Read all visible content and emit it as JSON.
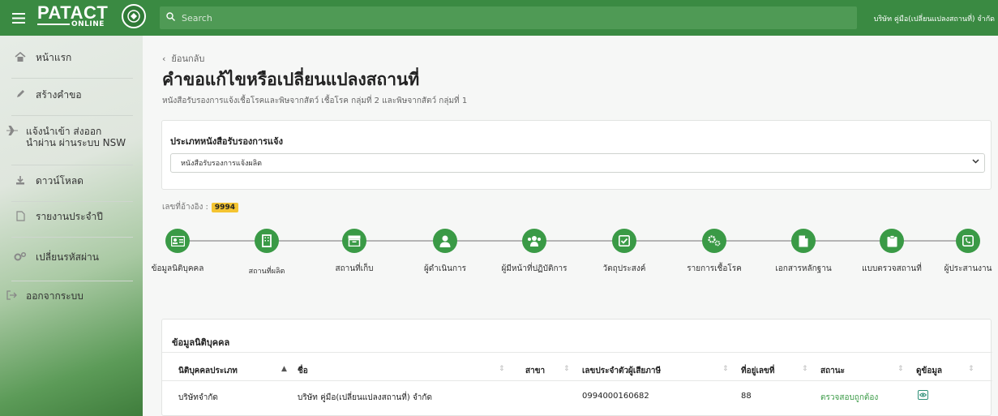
{
  "header": {
    "brand": "PATACT",
    "brand_sub": "ONLINE",
    "search_placeholder": "Search",
    "company": "บริษัท คู่มือ(เปลี่ยนแปลงสถานที่) จำกัด"
  },
  "sidebar": {
    "items": [
      {
        "label": "หน้าแรก",
        "icon": "home-icon"
      },
      {
        "label": "สร้างคำขอ",
        "icon": "pencil-icon"
      },
      {
        "label": "แจ้งนำเข้า ส่งออก\nนำผ่าน ผ่านระบบ NSW",
        "icon": "airplane-icon"
      },
      {
        "label": "ดาวน์โหลด",
        "icon": "download-icon"
      },
      {
        "label": "รายงานประจำปี",
        "icon": "file-icon"
      },
      {
        "label": "เปลี่ยนรหัสผ่าน",
        "icon": "gears-icon"
      },
      {
        "label": "ออกจากระบบ",
        "icon": "sign-out-icon"
      }
    ]
  },
  "main": {
    "back_label": "ย้อนกลับ",
    "title": "คำขอแก้ไขหรือเปลี่ยนแปลงสถานที่",
    "subtitle": "หนังสือรับรองการแจ้งเชื้อโรคและพิษจากสัตว์ เชื้อโรค กลุ่มที่ 2 และพิษจากสัตว์ กลุ่มที่ 1",
    "cert_type_title": "ประเภทหนังสือรับรองการแจ้ง",
    "cert_type_value": "หนังสือรับรองการแจ้งผลิต",
    "ref_label": "เลขที่อ้างอิง :",
    "ref_number": "9994"
  },
  "steps": [
    {
      "label": "ข้อมูลนิติบุคคล",
      "icon": "id-card-icon"
    },
    {
      "label": "สถานที่ผลิต",
      "icon": "building-icon"
    },
    {
      "label": "สถานที่เก็บ",
      "icon": "archive-box-icon"
    },
    {
      "label": "ผู้ดำเนินการ",
      "icon": "user-icon"
    },
    {
      "label": "ผู้มีหน้าที่ปฏิบัติการ",
      "icon": "users-icon"
    },
    {
      "label": "วัตถุประสงค์",
      "icon": "check-square-icon"
    },
    {
      "label": "รายการเชื้อโรค",
      "icon": "cogs-icon"
    },
    {
      "label": "เอกสารหลักฐาน",
      "icon": "document-icon"
    },
    {
      "label": "แบบตรวจสถานที่",
      "icon": "clipboard-icon"
    },
    {
      "label": "ผู้ประสานงาน",
      "icon": "phone-icon"
    }
  ],
  "entity_table": {
    "title": "ข้อมูลนิติบุคคล",
    "columns": [
      "นิติบุคคลประเภท",
      "ชื่อ",
      "สาขา",
      "เลขประจำตัวผู้เสียภาษี",
      "ที่อยู่เลขที่",
      "สถานะ",
      "ดูข้อมูล"
    ],
    "rows": [
      {
        "type": "บริษัทจำกัด",
        "name": "บริษัท คู่มือ(เปลี่ยนแปลงสถานที่) จำกัด",
        "branch": "",
        "tax_id": "0994000160682",
        "address_no": "88",
        "status": "ตรวจสอบถูกต้อง"
      }
    ]
  },
  "colors": {
    "topbar": "#3a8a42",
    "accent_green": "#3a9a46",
    "ref_badge": "#f4c431"
  }
}
